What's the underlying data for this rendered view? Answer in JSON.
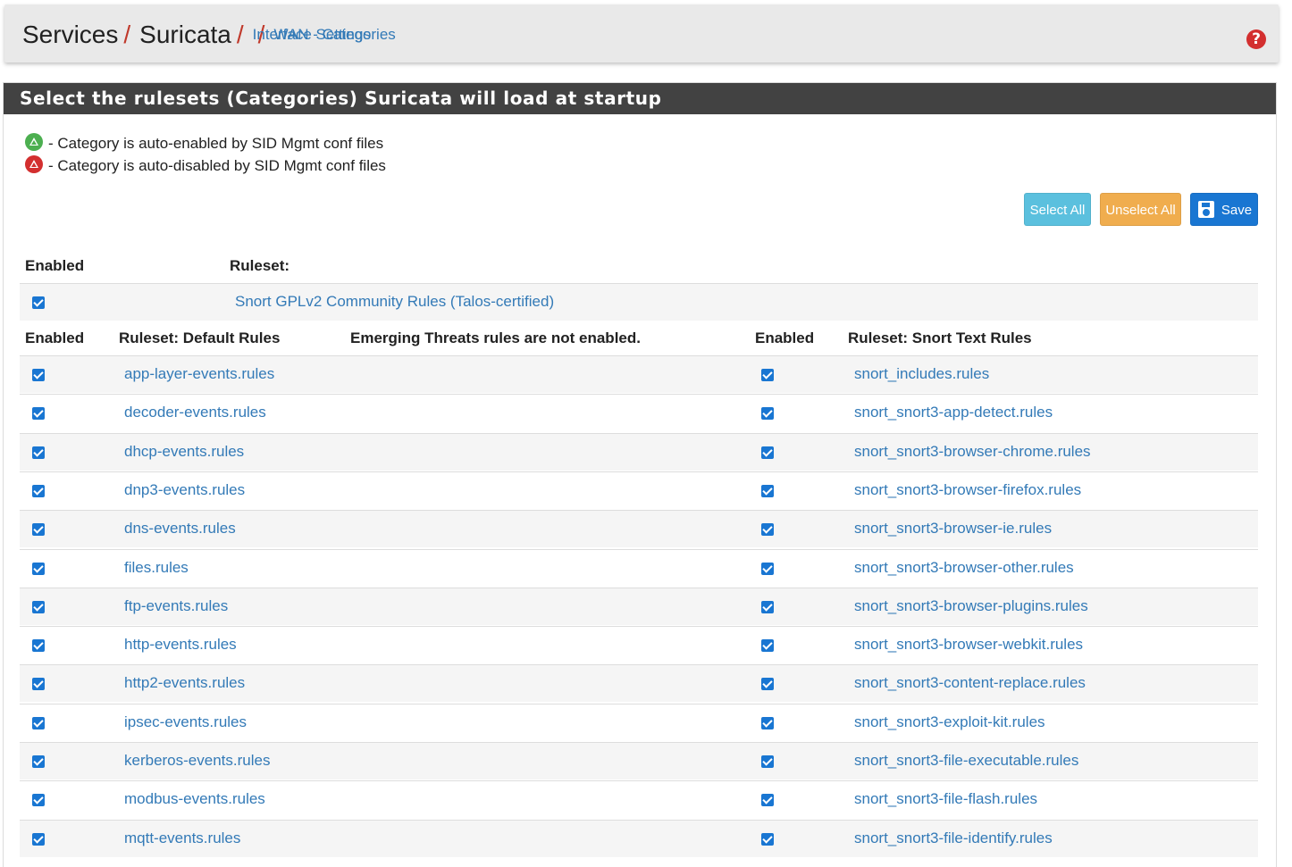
{
  "breadcrumb": {
    "items": [
      "Services",
      "Suricata",
      "Interface Settings",
      "WAN - Categories"
    ],
    "separator": "/"
  },
  "help_icon": "question-circle-icon",
  "panel": {
    "title": "Select the rulesets (Categories) Suricata will load at startup",
    "legend": [
      {
        "icon": "auto-enabled-icon",
        "color": "#4caf50",
        "text": "- Category is auto-enabled by SID Mgmt conf files"
      },
      {
        "icon": "auto-disabled-icon",
        "color": "#d32f2f",
        "text": "- Category is auto-disabled by SID Mgmt conf files"
      }
    ],
    "buttons": {
      "select_all": "Select All",
      "unselect_all": "Unselect All",
      "save": "Save"
    }
  },
  "community": {
    "header_enabled": "Enabled",
    "header_ruleset": "Ruleset:",
    "checked": true,
    "label": "Snort GPLv2 Community Rules (Talos-certified)"
  },
  "table": {
    "header_enabled_left": "Enabled",
    "header_default": "Ruleset: Default Rules",
    "header_et_note": "Emerging Threats rules are not enabled.",
    "header_enabled_right": "Enabled",
    "header_snort": "Ruleset: Snort Text Rules",
    "rows": [
      {
        "left": "app-layer-events.rules",
        "right": "snort_includes.rules"
      },
      {
        "left": "decoder-events.rules",
        "right": "snort_snort3-app-detect.rules"
      },
      {
        "left": "dhcp-events.rules",
        "right": "snort_snort3-browser-chrome.rules"
      },
      {
        "left": "dnp3-events.rules",
        "right": "snort_snort3-browser-firefox.rules"
      },
      {
        "left": "dns-events.rules",
        "right": "snort_snort3-browser-ie.rules"
      },
      {
        "left": "files.rules",
        "right": "snort_snort3-browser-other.rules"
      },
      {
        "left": "ftp-events.rules",
        "right": "snort_snort3-browser-plugins.rules"
      },
      {
        "left": "http-events.rules",
        "right": "snort_snort3-browser-webkit.rules"
      },
      {
        "left": "http2-events.rules",
        "right": "snort_snort3-content-replace.rules"
      },
      {
        "left": "ipsec-events.rules",
        "right": "snort_snort3-exploit-kit.rules"
      },
      {
        "left": "kerberos-events.rules",
        "right": "snort_snort3-file-executable.rules"
      },
      {
        "left": "modbus-events.rules",
        "right": "snort_snort3-file-flash.rules"
      },
      {
        "left": "mqtt-events.rules",
        "right": "snort_snort3-file-identify.rules"
      }
    ]
  },
  "colors": {
    "link": "#337ab7",
    "checkbox": "#1976d2",
    "heading_bg": "#424242",
    "separator": "#c0392b"
  }
}
